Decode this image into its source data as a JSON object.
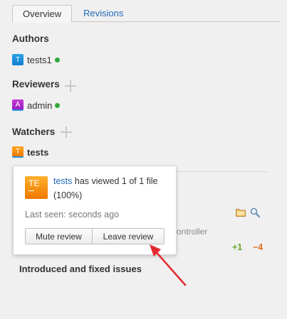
{
  "tabs": [
    {
      "label": "Overview",
      "active": true
    },
    {
      "label": "Revisions",
      "active": false
    }
  ],
  "sections": {
    "authors": {
      "title": "Authors",
      "users": [
        {
          "initial": "T",
          "name": "tests1",
          "online": true
        }
      ]
    },
    "reviewers": {
      "title": "Reviewers",
      "users": [
        {
          "initial": "A",
          "name": "admin",
          "online": true
        }
      ]
    },
    "watchers": {
      "title": "Watchers",
      "users": [
        {
          "initial": "T",
          "name": "tests",
          "online": false
        }
      ]
    }
  },
  "popup": {
    "avatar_initials": "TE",
    "user_link": "tests",
    "viewed_text": " has viewed 1 of 1 file",
    "percent_text": "(100%)",
    "last_seen": "Last seen: seconds ago",
    "mute_label": "Mute review",
    "leave_label": "Leave review"
  },
  "background": {
    "partial_text": "ontroller",
    "additions": "+1",
    "deletions": "−4",
    "issues_title": "Introduced and fixed issues"
  },
  "colors": {
    "link": "#1e6bb8",
    "online": "#2fa83a",
    "additions": "#6aa52a",
    "deletions": "#e07020",
    "arrow": "#e0292f"
  },
  "icons": [
    "plus-icon",
    "folder-icon",
    "search-icon",
    "arrow-annotation"
  ]
}
